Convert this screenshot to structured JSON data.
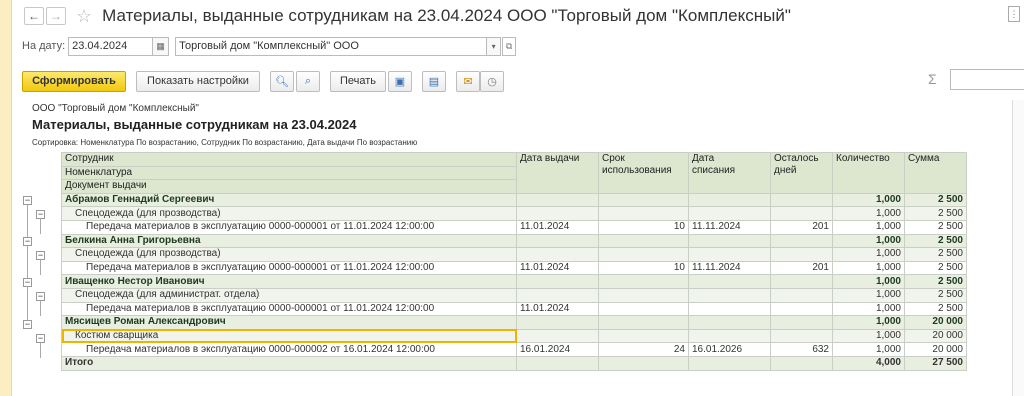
{
  "window": {
    "title": "Материалы, выданные сотрудникам на 23.04.2024 ООО \"Торговый дом \"Комплексный\""
  },
  "params": {
    "date_label": "На дату:",
    "date_value": "23.04.2024",
    "organization": "Торговый дом \"Комплексный\" ООО"
  },
  "toolbar": {
    "generate": "Сформировать",
    "show_settings": "Показать настройки",
    "print": "Печать",
    "sigma": "Σ"
  },
  "report": {
    "org": "ООО \"Торговый дом \"Комплексный\"",
    "title": "Материалы, выданные сотрудникам на 23.04.2024",
    "sort": "Сортировка: Номенклатура По возрастанию, Сотрудник По возрастанию, Дата выдачи По возрастанию",
    "headers": {
      "employee": "Сотрудник",
      "nomenclature": "Номенклатура",
      "document": "Документ выдачи",
      "issue_date": "Дата выдачи",
      "term_1": "Срок",
      "term_2": "использования",
      "writeoff_1": "Дата",
      "writeoff_2": "списания",
      "days_left_1": "Осталось",
      "days_left_2": "дней",
      "quantity": "Количество",
      "sum": "Сумма"
    },
    "rows": [
      {
        "type": "emp",
        "name": "Абрамов Геннадий Сергеевич",
        "date": "",
        "term": "",
        "writeoff": "",
        "days": "",
        "qty": "1,000",
        "sum": "2 500"
      },
      {
        "type": "nom",
        "name": "Спецодежда (для прозводства)",
        "date": "",
        "term": "",
        "writeoff": "",
        "days": "",
        "qty": "1,000",
        "sum": "2 500"
      },
      {
        "type": "doc",
        "name": "Передача материалов в эксплуатацию 0000-000001 от 11.01.2024 12:00:00",
        "date": "11.01.2024",
        "term": "10",
        "writeoff": "11.11.2024",
        "days": "201",
        "qty": "1,000",
        "sum": "2 500"
      },
      {
        "type": "emp",
        "name": "Белкина Анна Григорьевна",
        "date": "",
        "term": "",
        "writeoff": "",
        "days": "",
        "qty": "1,000",
        "sum": "2 500"
      },
      {
        "type": "nom",
        "name": "Спецодежда (для прозводства)",
        "date": "",
        "term": "",
        "writeoff": "",
        "days": "",
        "qty": "1,000",
        "sum": "2 500"
      },
      {
        "type": "doc",
        "name": "Передача материалов в эксплуатацию 0000-000001 от 11.01.2024 12:00:00",
        "date": "11.01.2024",
        "term": "10",
        "writeoff": "11.11.2024",
        "days": "201",
        "qty": "1,000",
        "sum": "2 500"
      },
      {
        "type": "emp",
        "name": "Иващенко Нестор Иванович",
        "date": "",
        "term": "",
        "writeoff": "",
        "days": "",
        "qty": "1,000",
        "sum": "2 500"
      },
      {
        "type": "nom",
        "name": "Спецодежда (для администрат. отдела)",
        "date": "",
        "term": "",
        "writeoff": "",
        "days": "",
        "qty": "1,000",
        "sum": "2 500"
      },
      {
        "type": "doc",
        "name": "Передача материалов в эксплуатацию 0000-000001 от 11.01.2024 12:00:00",
        "date": "11.01.2024",
        "term": "",
        "writeoff": "",
        "days": "",
        "qty": "1,000",
        "sum": "2 500"
      },
      {
        "type": "emp",
        "name": "Мясищев Роман Александрович",
        "date": "",
        "term": "",
        "writeoff": "",
        "days": "",
        "qty": "1,000",
        "sum": "20 000"
      },
      {
        "type": "nom",
        "name": "Костюм сварщика",
        "date": "",
        "term": "",
        "writeoff": "",
        "days": "",
        "qty": "1,000",
        "sum": "20 000",
        "selected": true
      },
      {
        "type": "doc",
        "name": "Передача материалов в эксплуатацию 0000-000002 от 16.01.2024 12:00:00",
        "date": "16.01.2024",
        "term": "24",
        "writeoff": "16.01.2026",
        "days": "632",
        "qty": "1,000",
        "sum": "20 000"
      }
    ],
    "total": {
      "label": "Итого",
      "qty": "4,000",
      "sum": "27 500"
    }
  }
}
